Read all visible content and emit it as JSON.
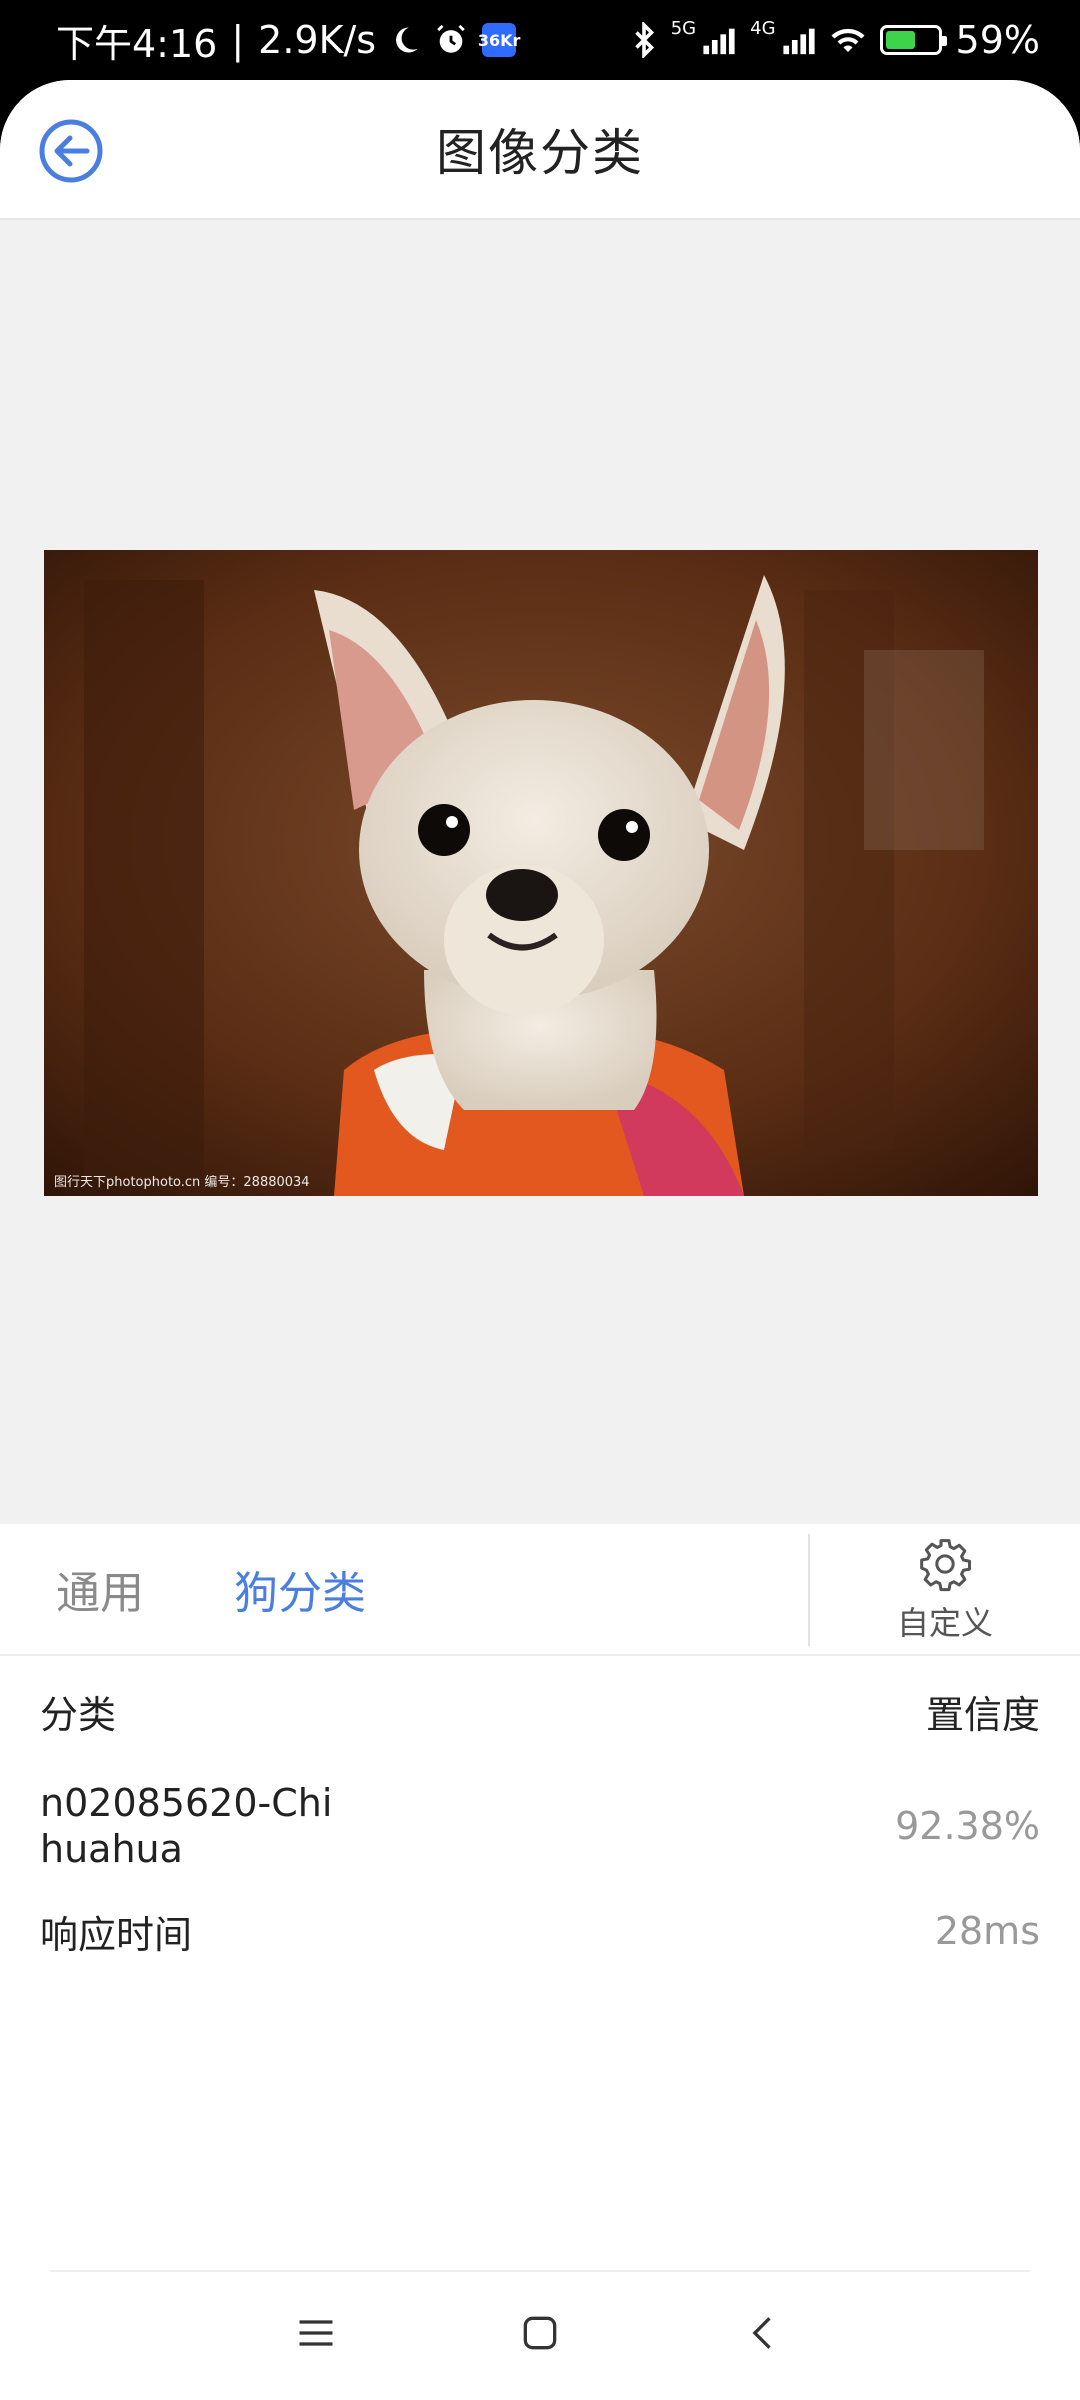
{
  "status_bar": {
    "time": "下午4:16",
    "speed": "2.9K/s",
    "app_badge": "36Kr",
    "sig1": "5G",
    "sig2": "4G",
    "battery": "59%",
    "battery_level": 0.59,
    "battery_color": "#3dd44b"
  },
  "header": {
    "title": "图像分类",
    "accent": "#4a7fe0"
  },
  "photo": {
    "caption": "图行天下photophoto.cn  编号：28880034"
  },
  "tabs": [
    {
      "label": "通用",
      "active": false
    },
    {
      "label": "狗分类",
      "active": true
    }
  ],
  "custom": {
    "label": "自定义"
  },
  "results": {
    "col_class": "分类",
    "col_conf": "置信度",
    "class_name": "n02085620-Chihuahua",
    "confidence": "92.38%",
    "time_label": "响应时间",
    "time_value": "28ms"
  }
}
